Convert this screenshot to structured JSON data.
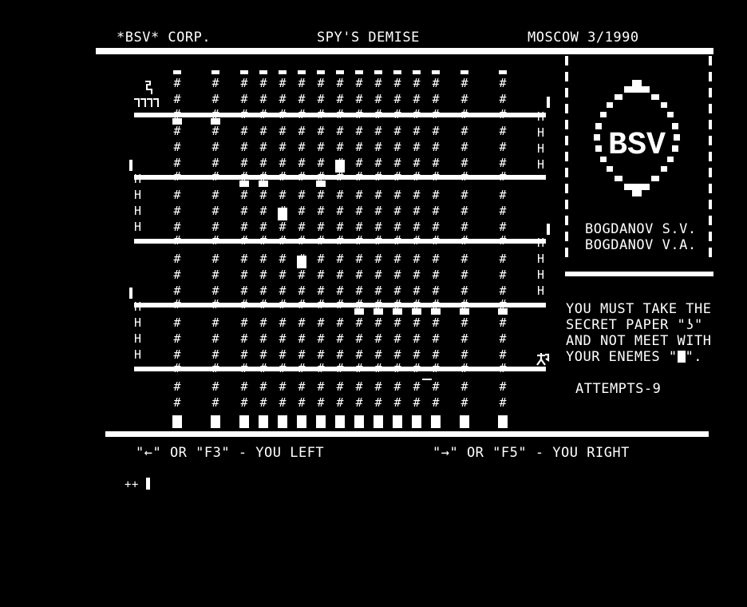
{
  "header": {
    "company": "*BSV* CORP.",
    "title": "SPY'S DEMISE",
    "place_date": "MOSCOW 3/1990"
  },
  "logo": {
    "text": "BSV",
    "authors": [
      "BOGDANOV S.V.",
      "BOGDANOV V.A."
    ]
  },
  "instructions": {
    "line1": "YOU MUST TAKE THE",
    "line2_prefix": "SECRET PAPER \"",
    "paper_glyph": "ʖ",
    "line2_suffix": "\"",
    "line3": "AND NOT MEET WITH",
    "line4_prefix": "YOUR ENEMES \"",
    "line4_suffix": "\"."
  },
  "status": {
    "attempts_label": "ATTEMPTS-9"
  },
  "controls": {
    "left": "\"←\" OR \"F3\" - YOU LEFT",
    "right": "\"→\" OR \"F5\" - YOU RIGHT"
  },
  "prompt": {
    "text": "++"
  },
  "colors": {
    "background": "#000000",
    "foreground": "#ffffff"
  },
  "icons": {
    "player": "spy-icon",
    "enemy": "enemy-block-icon",
    "paper": "secret-paper-icon"
  }
}
